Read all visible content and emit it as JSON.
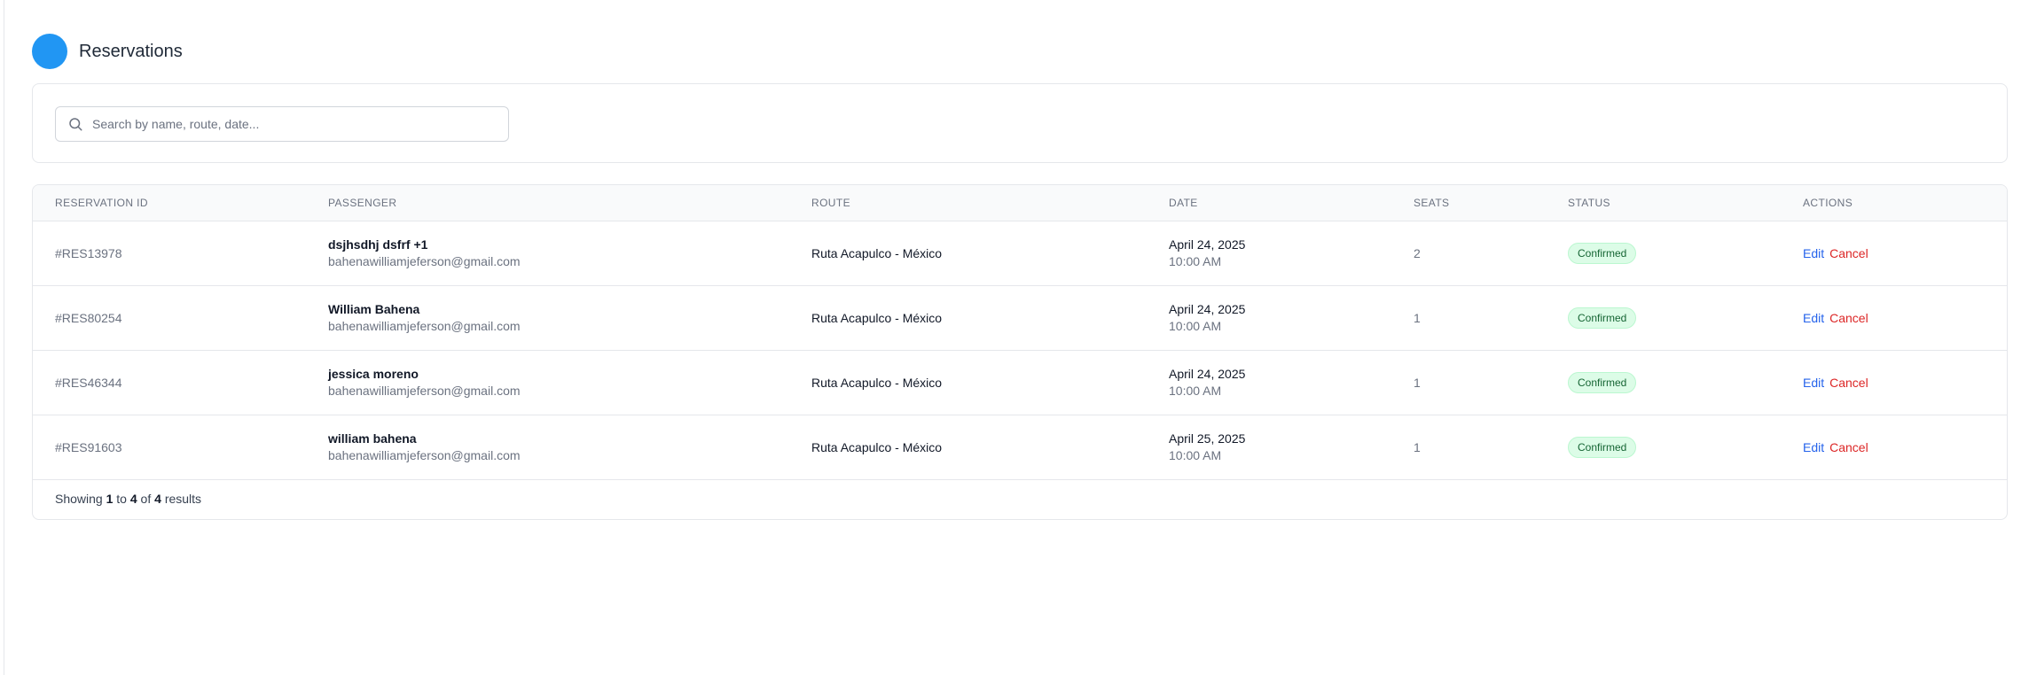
{
  "header": {
    "title": "Reservations",
    "logo_color": "#2196f3"
  },
  "search": {
    "placeholder": "Search by name, route, date...",
    "value": ""
  },
  "table": {
    "columns": [
      "RESERVATION ID",
      "PASSENGER",
      "ROUTE",
      "DATE",
      "SEATS",
      "STATUS",
      "ACTIONS"
    ],
    "rows": [
      {
        "id": "#RES13978",
        "name": "dsjhsdhj dsfrf +1",
        "email": "bahenawilliamjeferson@gmail.com",
        "route": "Ruta Acapulco - México",
        "date": "April 24, 2025",
        "time": "10:00 AM",
        "seats": "2",
        "status": "Confirmed",
        "edit": "Edit",
        "cancel": "Cancel"
      },
      {
        "id": "#RES80254",
        "name": "William Bahena",
        "email": "bahenawilliamjeferson@gmail.com",
        "route": "Ruta Acapulco - México",
        "date": "April 24, 2025",
        "time": "10:00 AM",
        "seats": "1",
        "status": "Confirmed",
        "edit": "Edit",
        "cancel": "Cancel"
      },
      {
        "id": "#RES46344",
        "name": "jessica moreno",
        "email": "bahenawilliamjeferson@gmail.com",
        "route": "Ruta Acapulco - México",
        "date": "April 24, 2025",
        "time": "10:00 AM",
        "seats": "1",
        "status": "Confirmed",
        "edit": "Edit",
        "cancel": "Cancel"
      },
      {
        "id": "#RES91603",
        "name": "william bahena",
        "email": "bahenawilliamjeferson@gmail.com",
        "route": "Ruta Acapulco - México",
        "date": "April 25, 2025",
        "time": "10:00 AM",
        "seats": "1",
        "status": "Confirmed",
        "edit": "Edit",
        "cancel": "Cancel"
      }
    ]
  },
  "pagination": {
    "prefix": "Showing",
    "from": "1",
    "to_word": "to",
    "to": "4",
    "of_word": "of",
    "total": "4",
    "suffix": "results"
  },
  "colors": {
    "accent": "#2563eb",
    "danger": "#dc2626",
    "success_bg": "#dcfce7",
    "success_text": "#166534"
  }
}
